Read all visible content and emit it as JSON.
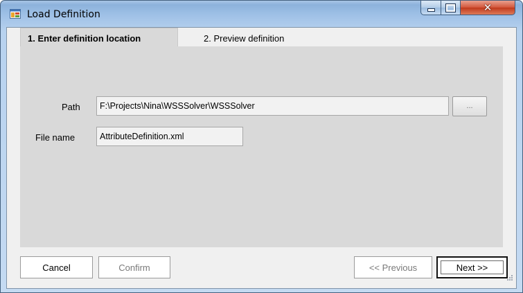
{
  "window": {
    "title": "Load Definition",
    "icon": "app-window-icon",
    "controls": {
      "minimize": "minimize-icon",
      "maximize": "maximize-icon",
      "close": "close-icon"
    }
  },
  "tabs": [
    {
      "label": "1. Enter definition location",
      "active": true
    },
    {
      "label": "2. Preview definition",
      "active": false
    }
  ],
  "form": {
    "path": {
      "label": "Path",
      "value": "F:\\Projects\\Nina\\WSSSolver\\WSSSolver"
    },
    "browse_label": "...",
    "file_name": {
      "label": "File name",
      "value": "AttributeDefinition.xml"
    }
  },
  "buttons": {
    "cancel": "Cancel",
    "confirm": "Confirm",
    "previous": "<< Previous",
    "next": "Next >>"
  },
  "colors": {
    "panel": "#d9d9d9",
    "client": "#f0f0f0",
    "close_red": "#c03a1c"
  }
}
